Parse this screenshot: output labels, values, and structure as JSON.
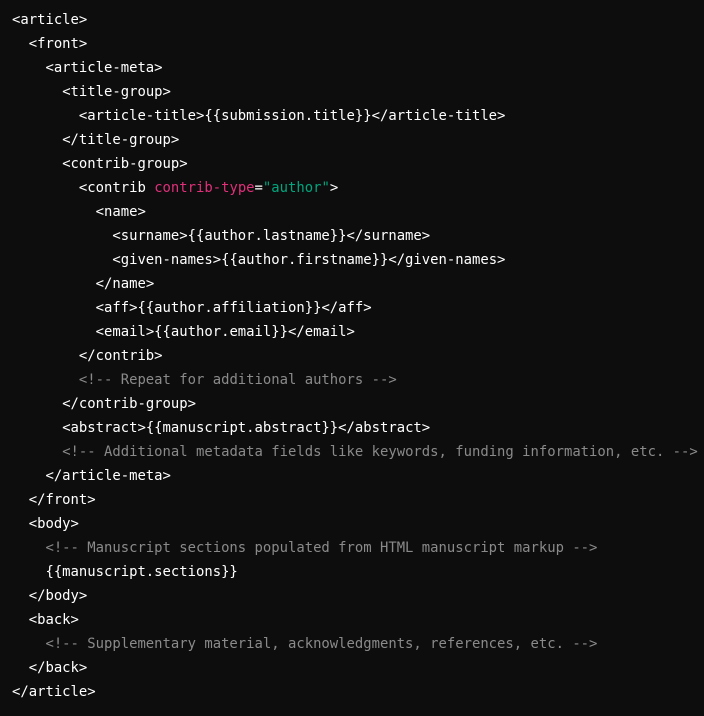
{
  "code_block": {
    "language": "xml",
    "colors": {
      "background": "#0d0d0d",
      "text": "#ffffff",
      "attribute": "#df3079",
      "string": "#00a67d",
      "comment": "#8a8a8a"
    },
    "lines": [
      {
        "indent": 0,
        "tokens": [
          {
            "type": "tag",
            "text": "<article>"
          }
        ]
      },
      {
        "indent": 1,
        "tokens": [
          {
            "type": "tag",
            "text": "<front>"
          }
        ]
      },
      {
        "indent": 2,
        "tokens": [
          {
            "type": "tag",
            "text": "<article-meta>"
          }
        ]
      },
      {
        "indent": 3,
        "tokens": [
          {
            "type": "tag",
            "text": "<title-group>"
          }
        ]
      },
      {
        "indent": 4,
        "tokens": [
          {
            "type": "tag",
            "text": "<article-title>{{submission.title}}</article-title>"
          }
        ]
      },
      {
        "indent": 3,
        "tokens": [
          {
            "type": "tag",
            "text": "</title-group>"
          }
        ]
      },
      {
        "indent": 3,
        "tokens": [
          {
            "type": "tag",
            "text": "<contrib-group>"
          }
        ]
      },
      {
        "indent": 4,
        "tokens": [
          {
            "type": "tag",
            "text": "<contrib "
          },
          {
            "type": "attr",
            "text": "contrib-type"
          },
          {
            "type": "punct",
            "text": "="
          },
          {
            "type": "str",
            "text": "\"author\""
          },
          {
            "type": "tag",
            "text": ">"
          }
        ]
      },
      {
        "indent": 5,
        "tokens": [
          {
            "type": "tag",
            "text": "<name>"
          }
        ]
      },
      {
        "indent": 6,
        "tokens": [
          {
            "type": "tag",
            "text": "<surname>{{author.lastname}}</surname>"
          }
        ]
      },
      {
        "indent": 6,
        "tokens": [
          {
            "type": "tag",
            "text": "<given-names>{{author.firstname}}</given-names>"
          }
        ]
      },
      {
        "indent": 5,
        "tokens": [
          {
            "type": "tag",
            "text": "</name>"
          }
        ]
      },
      {
        "indent": 5,
        "tokens": [
          {
            "type": "tag",
            "text": "<aff>{{author.affiliation}}</aff>"
          }
        ]
      },
      {
        "indent": 5,
        "tokens": [
          {
            "type": "tag",
            "text": "<email>{{author.email}}</email>"
          }
        ]
      },
      {
        "indent": 4,
        "tokens": [
          {
            "type": "tag",
            "text": "</contrib>"
          }
        ]
      },
      {
        "indent": 4,
        "tokens": [
          {
            "type": "comment",
            "text": "<!-- Repeat for additional authors -->"
          }
        ]
      },
      {
        "indent": 3,
        "tokens": [
          {
            "type": "tag",
            "text": "</contrib-group>"
          }
        ]
      },
      {
        "indent": 3,
        "tokens": [
          {
            "type": "tag",
            "text": "<abstract>{{manuscript.abstract}}</abstract>"
          }
        ]
      },
      {
        "indent": 3,
        "tokens": [
          {
            "type": "comment",
            "text": "<!-- Additional metadata fields like keywords, funding information, etc. -->"
          }
        ]
      },
      {
        "indent": 2,
        "tokens": [
          {
            "type": "tag",
            "text": "</article-meta>"
          }
        ]
      },
      {
        "indent": 1,
        "tokens": [
          {
            "type": "tag",
            "text": "</front>"
          }
        ]
      },
      {
        "indent": 1,
        "tokens": [
          {
            "type": "tag",
            "text": "<body>"
          }
        ]
      },
      {
        "indent": 2,
        "tokens": [
          {
            "type": "comment",
            "text": "<!-- Manuscript sections populated from HTML manuscript markup -->"
          }
        ]
      },
      {
        "indent": 2,
        "tokens": [
          {
            "type": "tag",
            "text": "{{manuscript.sections}}"
          }
        ]
      },
      {
        "indent": 1,
        "tokens": [
          {
            "type": "tag",
            "text": "</body>"
          }
        ]
      },
      {
        "indent": 1,
        "tokens": [
          {
            "type": "tag",
            "text": "<back>"
          }
        ]
      },
      {
        "indent": 2,
        "tokens": [
          {
            "type": "comment",
            "text": "<!-- Supplementary material, acknowledgments, references, etc. -->"
          }
        ]
      },
      {
        "indent": 1,
        "tokens": [
          {
            "type": "tag",
            "text": "</back>"
          }
        ]
      },
      {
        "indent": 0,
        "tokens": [
          {
            "type": "tag",
            "text": "</article>"
          }
        ]
      }
    ]
  }
}
